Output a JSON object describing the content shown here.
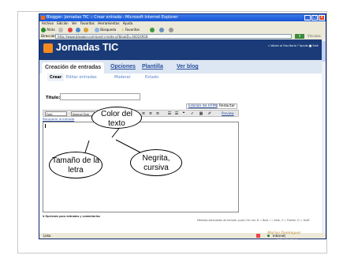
{
  "window": {
    "title": "Blogger: Jornadas TIC :: Crear entrada - Microsoft Internet Explorer",
    "controls": [
      "_",
      "□",
      "X"
    ]
  },
  "menubar": [
    "Archivo",
    "Edición",
    "Ver",
    "Favoritos",
    "Herramientas",
    "Ayuda"
  ],
  "navbar": {
    "back": "Atrás",
    "search": "Búsqueda",
    "favorites": "Favoritos"
  },
  "address": {
    "label": "Dirección",
    "url": "http://www.blogger.com/post-create.g?blogID=36024928",
    "go": "Ir",
    "links": "Vínculos"
  },
  "blog": {
    "name": "Jornadas TIC",
    "header_links": "« Volver al Escritorio   ? Ayuda   ■ Salir"
  },
  "tabs": [
    {
      "label": "Creación de entradas",
      "active": true
    },
    {
      "label": "Opciones",
      "active": false
    },
    {
      "label": "Plantilla",
      "active": false
    },
    {
      "label": "Ver blog",
      "active": false
    }
  ],
  "subtabs": [
    {
      "label": "Crear",
      "active": true
    },
    {
      "label": "Editar entradas",
      "active": false
    },
    {
      "label": "Moderar",
      "active": false
    },
    {
      "label": "Estado",
      "active": false
    }
  ],
  "editor": {
    "title_label": "Título:",
    "edit_html": "Edición de HTML",
    "compose": "Redactar",
    "font": "Font",
    "font_size": "Normal Size",
    "color_btn": "T",
    "bold_btn": "b",
    "italic_btn": "i",
    "preview": "Preview",
    "recover": "Recuperar la entrada",
    "options": "Opciones para entradas y comentarios",
    "shortcuts": "Métodos abreviados de teclado: pulse Ctrl con: B = Bold, I = Italic, S = Publish, D = Draft"
  },
  "statusbar": {
    "status": "Listo",
    "zone": "Internet"
  },
  "callouts": {
    "color": "Color del texto",
    "size": "Tamaño de la letra",
    "bold": "Negrita, cursiva"
  },
  "footer": {
    "author": "Marisa Dominguez",
    "subtitle": "Arte y Tecnología"
  }
}
